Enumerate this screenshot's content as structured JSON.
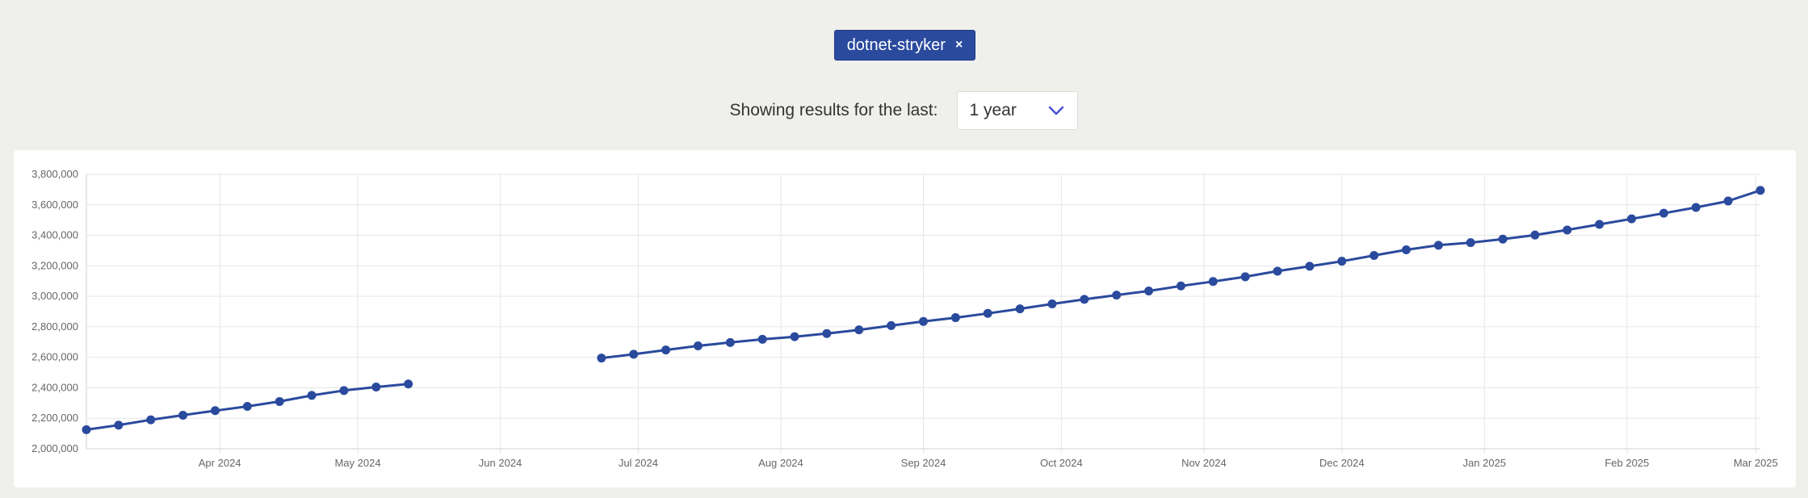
{
  "filter": {
    "tag_label": "dotnet-stryker",
    "tag_remove": "×"
  },
  "range": {
    "label": "Showing results for the last:",
    "selected": "1 year",
    "chevron_icon": "chevron-down-icon"
  },
  "colors": {
    "series": "#2a4a9d",
    "grid": "#e6e6e6",
    "axis_text": "#666666",
    "chevron": "#4b4fd1"
  },
  "chart_data": {
    "type": "line",
    "title": "",
    "xlabel": "",
    "ylabel": "",
    "ylim": [
      2000000,
      3800000
    ],
    "yticks": [
      2000000,
      2200000,
      2400000,
      2600000,
      2800000,
      3000000,
      3200000,
      3400000,
      3600000,
      3800000
    ],
    "ytick_labels": [
      "2,000,000",
      "2,200,000",
      "2,400,000",
      "2,600,000",
      "2,800,000",
      "3,000,000",
      "3,200,000",
      "3,400,000",
      "3,600,000",
      "3,800,000"
    ],
    "xlim": [
      "2024-03-03",
      "2025-03-02"
    ],
    "xticks": [
      "2024-04-01",
      "2024-05-01",
      "2024-06-01",
      "2024-07-01",
      "2024-08-01",
      "2024-09-01",
      "2024-10-01",
      "2024-11-01",
      "2024-12-01",
      "2025-01-01",
      "2025-02-01",
      "2025-03-01"
    ],
    "xtick_labels": [
      "Apr 2024",
      "May 2024",
      "Jun 2024",
      "Jul 2024",
      "Aug 2024",
      "Sep 2024",
      "Oct 2024",
      "Nov 2024",
      "Dec 2024",
      "Jan 2025",
      "Feb 2025",
      "Mar 2025"
    ],
    "grid": true,
    "legend": "none",
    "series": [
      {
        "segments": [
          [
            [
              "2024-03-03",
              2125000
            ],
            [
              "2024-03-10",
              2155000
            ],
            [
              "2024-03-17",
              2190000
            ],
            [
              "2024-03-24",
              2220000
            ],
            [
              "2024-03-31",
              2250000
            ],
            [
              "2024-04-07",
              2278000
            ],
            [
              "2024-04-14",
              2310000
            ],
            [
              "2024-04-21",
              2350000
            ],
            [
              "2024-04-28",
              2382000
            ],
            [
              "2024-05-05",
              2405000
            ],
            [
              "2024-05-12",
              2425000
            ]
          ],
          [
            [
              "2024-06-23",
              2595000
            ],
            [
              "2024-06-30",
              2620000
            ],
            [
              "2024-07-07",
              2648000
            ],
            [
              "2024-07-14",
              2675000
            ],
            [
              "2024-07-21",
              2697000
            ],
            [
              "2024-07-28",
              2718000
            ],
            [
              "2024-08-04",
              2735000
            ],
            [
              "2024-08-11",
              2756000
            ],
            [
              "2024-08-18",
              2780000
            ],
            [
              "2024-08-25",
              2808000
            ],
            [
              "2024-09-01",
              2835000
            ],
            [
              "2024-09-08",
              2860000
            ],
            [
              "2024-09-15",
              2888000
            ],
            [
              "2024-09-22",
              2918000
            ],
            [
              "2024-09-29",
              2950000
            ],
            [
              "2024-10-06",
              2980000
            ],
            [
              "2024-10-13",
              3008000
            ],
            [
              "2024-10-20",
              3035000
            ],
            [
              "2024-10-27",
              3068000
            ],
            [
              "2024-11-03",
              3097000
            ],
            [
              "2024-11-10",
              3128000
            ],
            [
              "2024-11-17",
              3165000
            ],
            [
              "2024-11-24",
              3197000
            ],
            [
              "2024-12-01",
              3230000
            ],
            [
              "2024-12-08",
              3268000
            ],
            [
              "2024-12-15",
              3305000
            ],
            [
              "2024-12-22",
              3335000
            ],
            [
              "2024-12-29",
              3352000
            ],
            [
              "2025-01-05",
              3375000
            ],
            [
              "2025-01-12",
              3402000
            ],
            [
              "2025-01-19",
              3435000
            ],
            [
              "2025-01-26",
              3472000
            ],
            [
              "2025-02-02",
              3508000
            ],
            [
              "2025-02-09",
              3545000
            ],
            [
              "2025-02-16",
              3583000
            ],
            [
              "2025-02-23",
              3625000
            ],
            [
              "2025-03-02",
              3695000
            ]
          ]
        ]
      }
    ]
  }
}
